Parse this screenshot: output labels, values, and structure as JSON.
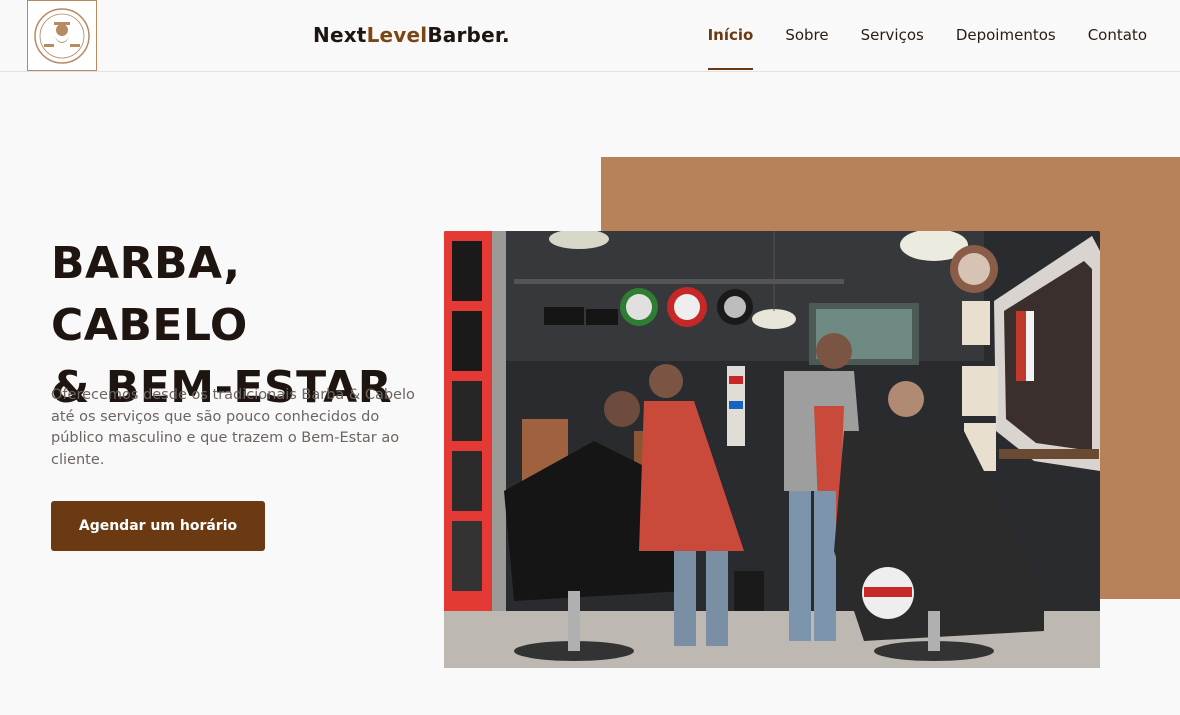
{
  "header": {
    "logo": {
      "icon": "barber-logo-icon",
      "text": "NEXT LEVEL BARBER"
    },
    "brand": {
      "part1": "Next",
      "part2": "Level",
      "part3": "Barber."
    },
    "nav": [
      {
        "label": "Início",
        "active": true
      },
      {
        "label": "Sobre",
        "active": false
      },
      {
        "label": "Serviços",
        "active": false
      },
      {
        "label": "Depoimentos",
        "active": false
      },
      {
        "label": "Contato",
        "active": false
      }
    ]
  },
  "hero": {
    "title_line1": "BARBA, CABELO",
    "title_line2": "& BEM-ESTAR",
    "text": "Oferecemos desde os tradicionais Barba & Cabelo até os serviços que são pouco conhecidos do público masculino e que trazem o Bem-Estar ao cliente.",
    "cta_label": "Agendar um horário",
    "image": "barbershop-photo"
  },
  "colors": {
    "accent": "#6b3a12",
    "tan": "#b7825a",
    "dark_text": "#1e1510",
    "body_text": "#6c6560",
    "background": "#f9f9f9"
  }
}
